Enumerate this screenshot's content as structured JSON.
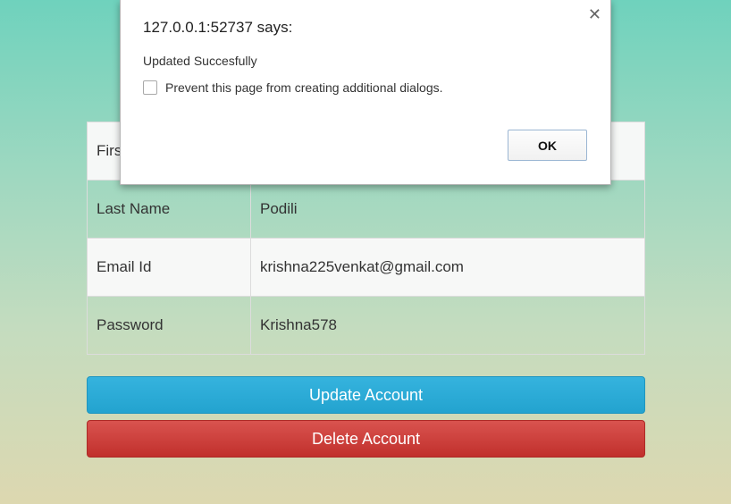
{
  "table": {
    "rows": [
      {
        "label": "First Name",
        "value": ""
      },
      {
        "label": "Last Name",
        "value": "Podili"
      },
      {
        "label": "Email Id",
        "value": "krishna225venkat@gmail.com"
      },
      {
        "label": "Password",
        "value": "Krishna578"
      }
    ]
  },
  "buttons": {
    "update_label": "Update Account",
    "delete_label": "Delete Account",
    "update_color": "#2aabd2",
    "delete_color": "#c9302c"
  },
  "dialog": {
    "title": "127.0.0.1:52737 says:",
    "message": "Updated Succesfully",
    "prevent_label": "Prevent this page from creating additional dialogs.",
    "ok_label": "OK",
    "close_icon": "close-icon",
    "prevent_checked": false
  }
}
